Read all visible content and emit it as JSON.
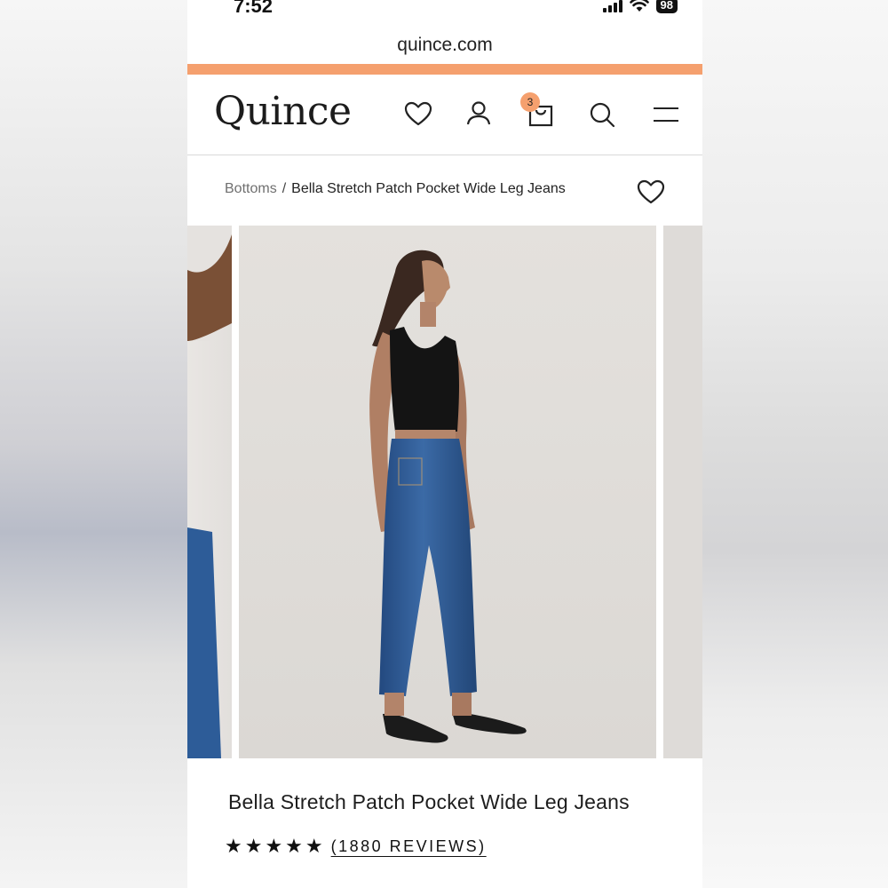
{
  "status_bar": {
    "time": "7:52",
    "battery": "98"
  },
  "browser": {
    "url": "quince.com"
  },
  "header": {
    "logo": "Quince",
    "cart_count": "3",
    "icons": [
      "heart-icon",
      "user-icon",
      "shopping-bag-icon",
      "search-icon",
      "menu-icon"
    ]
  },
  "breadcrumb": {
    "parent": "Bottoms",
    "separator": "/",
    "current": "Bella Stretch Patch Pocket Wide Leg Jeans"
  },
  "product": {
    "title": "Bella Stretch Patch Pocket Wide Leg Jeans",
    "stars": "★★★★★",
    "reviews_label": "(1880 REVIEWS)",
    "rating": 5
  },
  "colors": {
    "accent": "#f5a06e",
    "denim": "#2f5a93",
    "top": "#141414",
    "background_photo": "#e4e1dd"
  }
}
